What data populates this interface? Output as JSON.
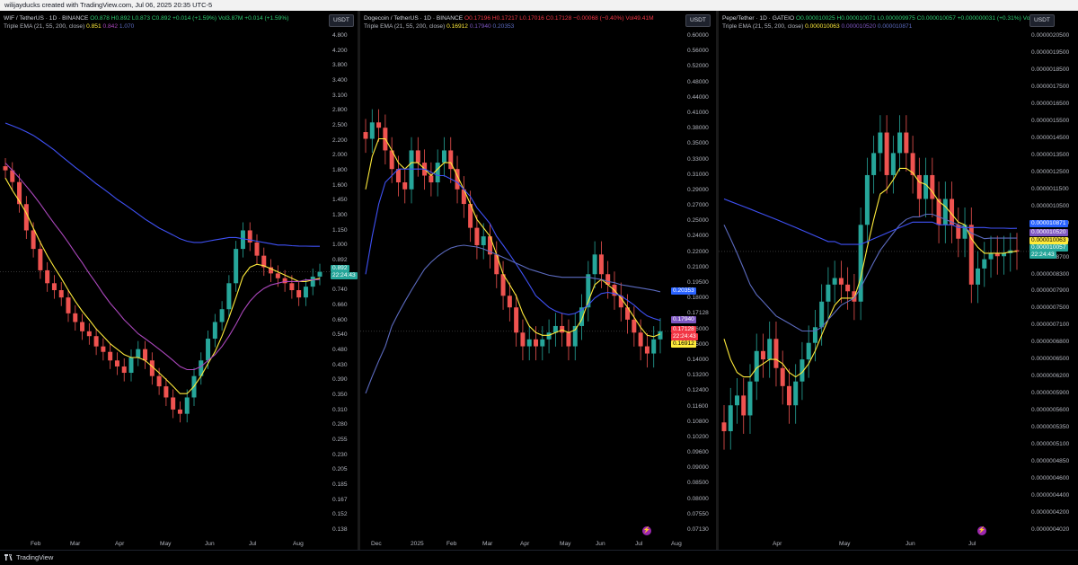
{
  "header": {
    "attribution": "wilijayducks created with TradingView.com, Jul 06, 2025 20:35 UTC-5"
  },
  "footer": {
    "brand": "TradingView"
  },
  "chart_data": [
    {
      "type": "candlestick",
      "symbol_line": "WIF / TetherUS · 1D · BINANCE",
      "ohlc": {
        "o": "O0.878",
        "h": "H0.892",
        "l": "L0.873",
        "c": "C0.892",
        "chg": "+0.014 (+1.59%)",
        "vol": "Vol3.87M",
        "vol_chg": "+0.014 (+1.59%)"
      },
      "indicator": "Triple EMA (21, 55, 200, close)",
      "ema_values": [
        "0.851",
        "0.842",
        "1.070"
      ],
      "currency": "USDT",
      "y_scale": "log",
      "y_ticks": [
        "4.800",
        "4.200",
        "3.800",
        "3.400",
        "3.100",
        "2.800",
        "2.500",
        "2.200",
        "2.000",
        "1.800",
        "1.600",
        "1.450",
        "1.300",
        "1.150",
        "1.000",
        "0.892",
        "0.820",
        "0.740",
        "0.660",
        "0.600",
        "0.540",
        "0.480",
        "0.430",
        "0.390",
        "0.350",
        "0.310",
        "0.280",
        "0.255",
        "0.230",
        "0.205",
        "0.185",
        "0.167",
        "0.152",
        "0.138"
      ],
      "x_ticks": [
        "Feb",
        "Mar",
        "Apr",
        "May",
        "Jun",
        "Jul",
        "Aug"
      ],
      "last_price": "0.892",
      "countdown": "22:24:43",
      "ylim": [
        0.135,
        5.0
      ],
      "close_series": [
        1.85,
        1.7,
        1.45,
        1.2,
        1.05,
        0.9,
        0.82,
        0.78,
        0.74,
        0.66,
        0.62,
        0.58,
        0.56,
        0.52,
        0.5,
        0.47,
        0.45,
        0.43,
        0.48,
        0.51,
        0.47,
        0.42,
        0.39,
        0.36,
        0.33,
        0.32,
        0.36,
        0.42,
        0.47,
        0.55,
        0.62,
        0.68,
        0.82,
        1.05,
        1.2,
        1.1,
        1.0,
        0.92,
        0.88,
        0.85,
        0.82,
        0.78,
        0.74,
        0.8,
        0.86,
        0.89
      ],
      "ema21": [
        1.75,
        1.6,
        1.48,
        1.36,
        1.22,
        1.1,
        1.0,
        0.92,
        0.85,
        0.78,
        0.72,
        0.67,
        0.63,
        0.59,
        0.56,
        0.53,
        0.51,
        0.49,
        0.48,
        0.48,
        0.47,
        0.45,
        0.43,
        0.41,
        0.39,
        0.37,
        0.37,
        0.39,
        0.42,
        0.46,
        0.5,
        0.56,
        0.64,
        0.74,
        0.86,
        0.92,
        0.94,
        0.93,
        0.91,
        0.89,
        0.87,
        0.85,
        0.83,
        0.83,
        0.84,
        0.85
      ],
      "ema55": [
        1.95,
        1.85,
        1.75,
        1.65,
        1.55,
        1.45,
        1.35,
        1.26,
        1.18,
        1.1,
        1.02,
        0.95,
        0.88,
        0.82,
        0.76,
        0.71,
        0.67,
        0.63,
        0.6,
        0.57,
        0.55,
        0.53,
        0.51,
        0.49,
        0.47,
        0.45,
        0.44,
        0.44,
        0.45,
        0.47,
        0.49,
        0.52,
        0.56,
        0.61,
        0.67,
        0.72,
        0.76,
        0.79,
        0.81,
        0.82,
        0.83,
        0.83,
        0.83,
        0.84,
        0.84,
        0.842
      ],
      "ema200": [
        2.6,
        2.55,
        2.5,
        2.44,
        2.38,
        2.3,
        2.22,
        2.14,
        2.05,
        1.97,
        1.89,
        1.82,
        1.75,
        1.68,
        1.62,
        1.56,
        1.5,
        1.45,
        1.4,
        1.35,
        1.3,
        1.26,
        1.22,
        1.19,
        1.16,
        1.13,
        1.11,
        1.1,
        1.1,
        1.11,
        1.12,
        1.13,
        1.14,
        1.14,
        1.13,
        1.12,
        1.11,
        1.1,
        1.09,
        1.08,
        1.08,
        1.075,
        1.072,
        1.071,
        1.07,
        1.07
      ]
    },
    {
      "type": "candlestick",
      "symbol_line": "Dogecoin / TetherUS · 1D · BINANCE",
      "ohlc": {
        "o": "O0.17196",
        "h": "H0.17217",
        "l": "L0.17016",
        "c": "C0.17128",
        "chg": "−0.00068 (−0.40%)",
        "vol": "Vol49.41M"
      },
      "indicator": "Triple EMA (21, 55, 200, close)",
      "ema_values": [
        "0.16912",
        "0.17940",
        "0.20353"
      ],
      "currency": "USDT",
      "y_scale": "log",
      "y_ticks": [
        "0.60000",
        "0.56000",
        "0.52000",
        "0.48000",
        "0.44000",
        "0.41000",
        "0.38000",
        "0.35000",
        "0.33000",
        "0.31000",
        "0.29000",
        "0.27000",
        "0.25000",
        "0.24000",
        "0.22000",
        "0.21000",
        "0.19500",
        "0.18000",
        "0.17128",
        "0.16000",
        "0.15000",
        "0.14000",
        "0.13200",
        "0.12400",
        "0.11600",
        "0.10800",
        "0.10200",
        "0.09600",
        "0.09000",
        "0.08500",
        "0.08000",
        "0.07550",
        "0.07130"
      ],
      "x_ticks": [
        "Dec",
        "2025",
        "Feb",
        "Mar",
        "Apr",
        "May",
        "Jun",
        "Jul",
        "Aug"
      ],
      "tags": [
        "0.20353",
        "0.17940",
        "0.17128",
        "22:24:43",
        "0.16912"
      ],
      "ylim": [
        0.07,
        0.64
      ],
      "close_series": [
        0.4,
        0.43,
        0.42,
        0.38,
        0.35,
        0.33,
        0.32,
        0.38,
        0.36,
        0.34,
        0.33,
        0.36,
        0.38,
        0.35,
        0.32,
        0.3,
        0.27,
        0.25,
        0.26,
        0.24,
        0.22,
        0.2,
        0.19,
        0.17,
        0.16,
        0.165,
        0.16,
        0.165,
        0.17,
        0.175,
        0.17,
        0.16,
        0.175,
        0.19,
        0.22,
        0.24,
        0.22,
        0.21,
        0.2,
        0.19,
        0.18,
        0.17,
        0.16,
        0.155,
        0.165,
        0.171
      ],
      "ema21": [
        0.32,
        0.37,
        0.4,
        0.4,
        0.38,
        0.36,
        0.35,
        0.36,
        0.36,
        0.35,
        0.34,
        0.35,
        0.36,
        0.36,
        0.34,
        0.32,
        0.3,
        0.28,
        0.27,
        0.26,
        0.24,
        0.22,
        0.21,
        0.2,
        0.185,
        0.175,
        0.17,
        0.168,
        0.168,
        0.17,
        0.172,
        0.17,
        0.172,
        0.18,
        0.195,
        0.21,
        0.215,
        0.21,
        0.205,
        0.198,
        0.19,
        0.182,
        0.174,
        0.168,
        0.167,
        0.169
      ],
      "ema55": [
        0.22,
        0.26,
        0.3,
        0.33,
        0.34,
        0.35,
        0.35,
        0.35,
        0.35,
        0.35,
        0.345,
        0.34,
        0.34,
        0.335,
        0.33,
        0.32,
        0.31,
        0.295,
        0.285,
        0.275,
        0.26,
        0.25,
        0.24,
        0.23,
        0.22,
        0.21,
        0.2,
        0.195,
        0.19,
        0.187,
        0.185,
        0.184,
        0.185,
        0.188,
        0.192,
        0.198,
        0.202,
        0.203,
        0.202,
        0.2,
        0.196,
        0.192,
        0.187,
        0.183,
        0.181,
        0.1794
      ],
      "ema200": [
        0.13,
        0.14,
        0.15,
        0.16,
        0.175,
        0.185,
        0.195,
        0.205,
        0.215,
        0.225,
        0.232,
        0.238,
        0.243,
        0.247,
        0.249,
        0.25,
        0.249,
        0.248,
        0.246,
        0.243,
        0.24,
        0.237,
        0.234,
        0.231,
        0.228,
        0.225,
        0.223,
        0.221,
        0.219,
        0.218,
        0.217,
        0.217,
        0.217,
        0.217,
        0.217,
        0.216,
        0.215,
        0.213,
        0.212,
        0.21,
        0.209,
        0.208,
        0.207,
        0.206,
        0.205,
        0.2035
      ]
    },
    {
      "type": "candlestick",
      "symbol_line": "Pepe/Tether · 1D · GATEIO",
      "ohlc": {
        "o": "O0.000010025",
        "h": "H0.000010071",
        "l": "L0.000009975",
        "c": "C0.000010057",
        "chg": "+0.000000031 (+0.31%)",
        "vol": "Vol"
      },
      "indicator": "Triple EMA (21, 55, 200, close)",
      "ema_values": [
        "0.000010063",
        "0.000010520",
        "0.000010871"
      ],
      "currency": "USDT",
      "y_scale": "log",
      "y_ticks": [
        "0.0000020500",
        "0.0000019500",
        "0.0000018500",
        "0.0000017500",
        "0.0000016500",
        "0.0000015500",
        "0.0000014500",
        "0.0000013500",
        "0.0000012500",
        "0.0000011500",
        "0.0000010500",
        "0.0000009700",
        "0.0000009100",
        "0.0000008700",
        "0.0000008300",
        "0.0000007900",
        "0.0000007500",
        "0.0000007100",
        "0.0000006800",
        "0.0000006500",
        "0.0000006200",
        "0.0000005900",
        "0.0000005600",
        "0.0000005350",
        "0.0000005100",
        "0.0000004850",
        "0.0000004600",
        "0.0000004400",
        "0.0000004200",
        "0.0000004020"
      ],
      "x_ticks": [
        "Apr",
        "May",
        "Jun",
        "Jul"
      ],
      "tags": [
        "0.000010871",
        "0.000010520",
        "0.000010063",
        "0.000010057",
        "22:24:43"
      ],
      "ylim": [
        3.9e-07,
        2.1e-06
      ],
      "close_series": [
        5.5e-07,
        6e-07,
        6.2e-07,
        5.8e-07,
        6.5e-07,
        7.2e-07,
        7e-07,
        7.5e-07,
        6.8e-07,
        6.4e-07,
        6e-07,
        6.5e-07,
        7e-07,
        7.4e-07,
        7.8e-07,
        8.5e-07,
        9e-07,
        9.2e-07,
        9e-07,
        8.8e-07,
        8.5e-07,
        1.1e-06,
        1.3e-06,
        1.4e-06,
        1.5e-06,
        1.3e-06,
        1.4e-06,
        1.5e-06,
        1.4e-06,
        1.3e-06,
        1.2e-06,
        1.3e-06,
        1.2e-06,
        1.1e-06,
        1.2e-06,
        1.1e-06,
        1.05e-06,
        1.1e-06,
        9e-07,
        9.5e-07,
        9.8e-07,
        1e-06,
        9.9e-07,
        1e-06,
        1.01e-06,
        1.006e-06
      ],
      "ema21": [
        7.5e-07,
        7e-07,
        6.7e-07,
        6.6e-07,
        6.6e-07,
        6.8e-07,
        6.9e-07,
        7e-07,
        7e-07,
        6.9e-07,
        6.7e-07,
        6.6e-07,
        6.7e-07,
        6.9e-07,
        7.2e-07,
        7.6e-07,
        8e-07,
        8.4e-07,
        8.6e-07,
        8.6e-07,
        8.6e-07,
        9.2e-07,
        1.02e-06,
        1.12e-06,
        1.22e-06,
        1.24e-06,
        1.28e-06,
        1.33e-06,
        1.33e-06,
        1.31e-06,
        1.27e-06,
        1.26e-06,
        1.23e-06,
        1.19e-06,
        1.17e-06,
        1.14e-06,
        1.11e-06,
        1.1e-06,
        1.05e-06,
        1.02e-06,
        1e-06,
        1e-06,
        1e-06,
        1e-06,
        1.005e-06,
        1.0063e-06
      ],
      "ema55": [
        1.1e-06,
        1.05e-06,
        1e-06,
        9.5e-07,
        9e-07,
        8.7e-07,
        8.5e-07,
        8.3e-07,
        8.1e-07,
        8e-07,
        7.9e-07,
        7.8e-07,
        7.7e-07,
        7.7e-07,
        7.7e-07,
        7.8e-07,
        8e-07,
        8.2e-07,
        8.4e-07,
        8.5e-07,
        8.6e-07,
        8.9e-07,
        9.3e-07,
        9.7e-07,
        1.01e-06,
        1.04e-06,
        1.07e-06,
        1.1e-06,
        1.12e-06,
        1.13e-06,
        1.13e-06,
        1.14e-06,
        1.14e-06,
        1.13e-06,
        1.12e-06,
        1.11e-06,
        1.1e-06,
        1.09e-06,
        1.07e-06,
        1.06e-06,
        1.05e-06,
        1.052e-06,
        1.052e-06,
        1.052e-06,
        1.052e-06,
        1.052e-06
      ],
      "ema200": [
        1.2e-06,
        1.19e-06,
        1.18e-06,
        1.17e-06,
        1.16e-06,
        1.15e-06,
        1.14e-06,
        1.13e-06,
        1.12e-06,
        1.11e-06,
        1.1e-06,
        1.09e-06,
        1.08e-06,
        1.07e-06,
        1.06e-06,
        1.05e-06,
        1.04e-06,
        1.04e-06,
        1.03e-06,
        1.03e-06,
        1.03e-06,
        1.03e-06,
        1.04e-06,
        1.05e-06,
        1.06e-06,
        1.07e-06,
        1.08e-06,
        1.09e-06,
        1.1e-06,
        1.11e-06,
        1.11e-06,
        1.11e-06,
        1.11e-06,
        1.1e-06,
        1.1e-06,
        1.1e-06,
        1.09e-06,
        1.09e-06,
        1.09e-06,
        1.09e-06,
        1.09e-06,
        1.088e-06,
        1.088e-06,
        1.088e-06,
        1.087e-06,
        1.0871e-06
      ]
    }
  ],
  "colors": {
    "up": "#26a69a",
    "down": "#ef5350",
    "ema21": "#ffeb3b",
    "ema55": "#ab47bc",
    "ema200": "#3f51f5",
    "ema55_doge": "#3f51f5",
    "ema200_doge": "#5c6bc0"
  }
}
